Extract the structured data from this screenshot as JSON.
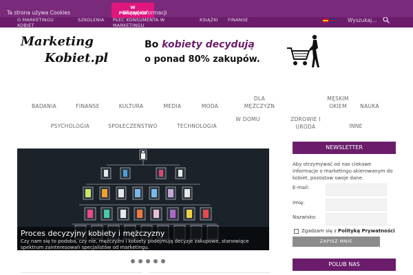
{
  "cookie": {
    "text": "Ta strona używa Cookies",
    "accept_line1": "W",
    "accept_line2": "PORZĄDKU",
    "more": "Więcej informacji"
  },
  "topnav": {
    "items": [
      {
        "line1": "O MARKETINGU",
        "line2": "KOBIET"
      },
      {
        "line1": "SZKOLENIA",
        "line2": ""
      },
      {
        "line1": "PŁEĆ KONSUMENTA W",
        "line2": "MARKETINGU"
      },
      {
        "line1": "KSIĄŻKI",
        "line2": ""
      },
      {
        "line1": "FINANSE",
        "line2": ""
      }
    ],
    "search_placeholder": "Wyszukaj...",
    "search_icon": "search-icon"
  },
  "logo": {
    "line1": "Marketing",
    "line2": "Kobiet.pl"
  },
  "banner": {
    "line1_prefix": "Bo ",
    "line1_accent": "kobiety decydują",
    "line2": "o ponad 80% zakupów."
  },
  "categories": [
    {
      "label": "BADANIA"
    },
    {
      "label": "FINANSE"
    },
    {
      "label": "KULTURA"
    },
    {
      "label": "MEDIA"
    },
    {
      "label": "MODA"
    },
    {
      "label": "DLA MĘŻCZYZN"
    },
    {
      "label": "MĘSKIM OKIEM"
    },
    {
      "label": "NAUKA"
    },
    {
      "label": "PSYCHOLOGIA"
    },
    {
      "label": "SPOŁECZEŃSTWO"
    },
    {
      "label": "TECHNOLOGIA"
    },
    {
      "label": "W DOMU"
    },
    {
      "label": "ZDROWIE I URODA"
    },
    {
      "label": "INNE"
    }
  ],
  "slider": {
    "title": "Proces decyzyjny kobiety i mężczyzny",
    "text": "Czy nam się to podoba, czy nie, mężczyźni i kobiety podejmują decyzje zakupowe, stanowiące spektrum zainteresowań specjalistów od marketingu.",
    "slide_count": 5,
    "active_slide": 1
  },
  "newsletter": {
    "heading": "NEWSLETTER",
    "description": "Aby otrzymywać od nas ciekawe informacje o marketingu skierowanym do kobiet, pozostaw swoje dane.",
    "email_label": "E-mail:",
    "first_name_label": "Imię:",
    "last_name_label": "Nazwisko:",
    "consent_prefix": "Zgadzam się z ",
    "consent_link": "Polityką Prywatności",
    "submit": "ZAPISZ MNIE"
  },
  "social": {
    "heading": "POLUB NAS"
  },
  "colors": {
    "brand": "#6b1d6b",
    "accent": "#e0167e"
  }
}
